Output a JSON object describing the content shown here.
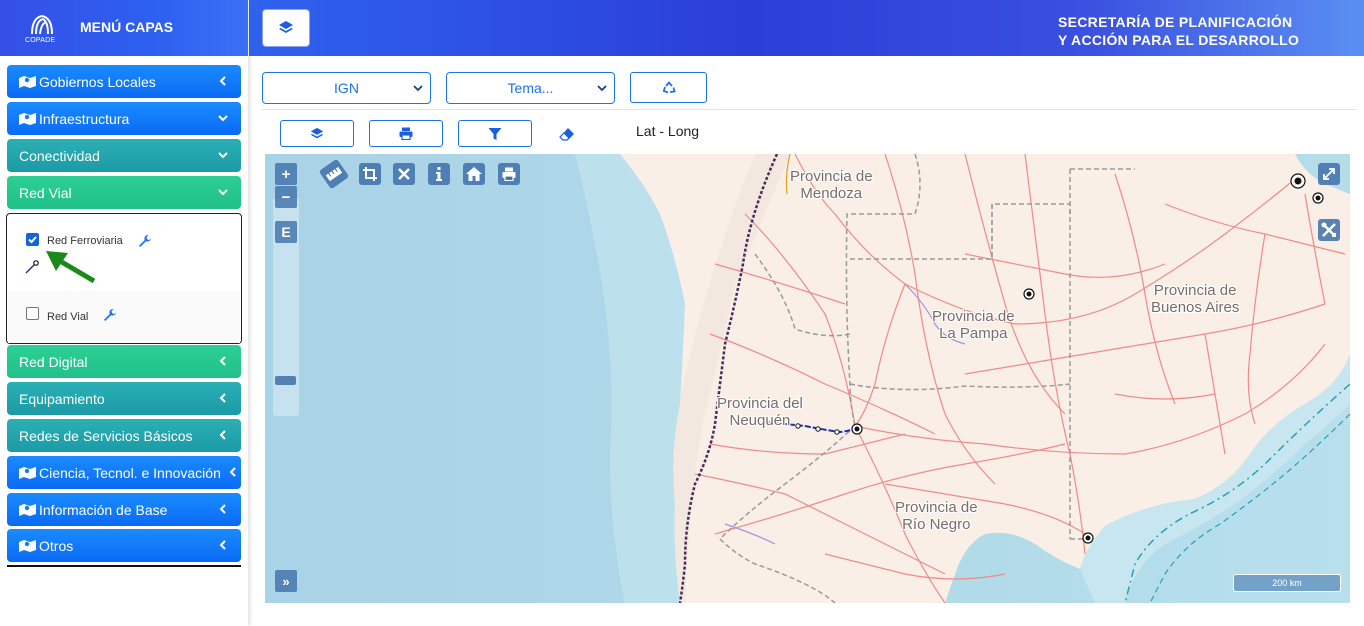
{
  "sidebar": {
    "logo_text": "COPADE",
    "menu_title": "MENÚ CAPAS",
    "items": [
      {
        "label": "Gobiernos Locales",
        "icon": "map-icon",
        "chevron": "left"
      },
      {
        "label": "Infraestructura",
        "icon": "map-icon",
        "chevron": "down"
      },
      {
        "label": "Conectividad",
        "icon": "",
        "chevron": "down"
      },
      {
        "label": "Red Vial",
        "icon": "",
        "chevron": "down"
      },
      {
        "label": "Red Digital",
        "icon": "",
        "chevron": "left"
      },
      {
        "label": "Equipamiento",
        "icon": "",
        "chevron": "left"
      },
      {
        "label": "Redes de Servicios Básicos",
        "icon": "",
        "chevron": "left"
      },
      {
        "label": "Ciencia, Tecnol. e Innovación",
        "icon": "map-icon",
        "chevron": "left"
      },
      {
        "label": "Información de Base",
        "icon": "map-icon",
        "chevron": "left"
      },
      {
        "label": "Otros",
        "icon": "map-icon",
        "chevron": "left"
      }
    ],
    "red_vial_layers": [
      {
        "label": "Red Ferroviaria",
        "checked": true
      },
      {
        "label": "Red Vial",
        "checked": false
      }
    ]
  },
  "header": {
    "org_line1": "SECRETARÍA DE PLANIFICACIÓN",
    "org_line2": "Y ACCIÓN PARA EL DESARROLLO"
  },
  "controls": {
    "base_select": "IGN",
    "theme_select": "Tema...",
    "lat_long_label": "Lat - Long"
  },
  "map": {
    "zoom_in": "+",
    "zoom_out": "−",
    "extent_button": "E",
    "expand_button": "»",
    "scale_label": "200 km",
    "labels": [
      {
        "line1": "Provincia de",
        "line2": "Mendoza"
      },
      {
        "line1": "Provincia de",
        "line2": "La Pampa"
      },
      {
        "line1": "Provincia de",
        "line2": "Buenos Aires"
      },
      {
        "line1": "Provincia del",
        "line2": "Neuquén"
      },
      {
        "line1": "Provincia de",
        "line2": "Río Negro"
      }
    ]
  },
  "colors": {
    "primary": "#1a73e8",
    "menu_blue": "#0a6af5",
    "menu_teal": "#1c9aa6",
    "menu_green": "#21c189",
    "sea": "#aad3df",
    "land": "#f9efe6",
    "road": "#ef8a8a",
    "rail_highlight": "#1d2fb0",
    "annotation_arrow": "#1a8a1a"
  }
}
